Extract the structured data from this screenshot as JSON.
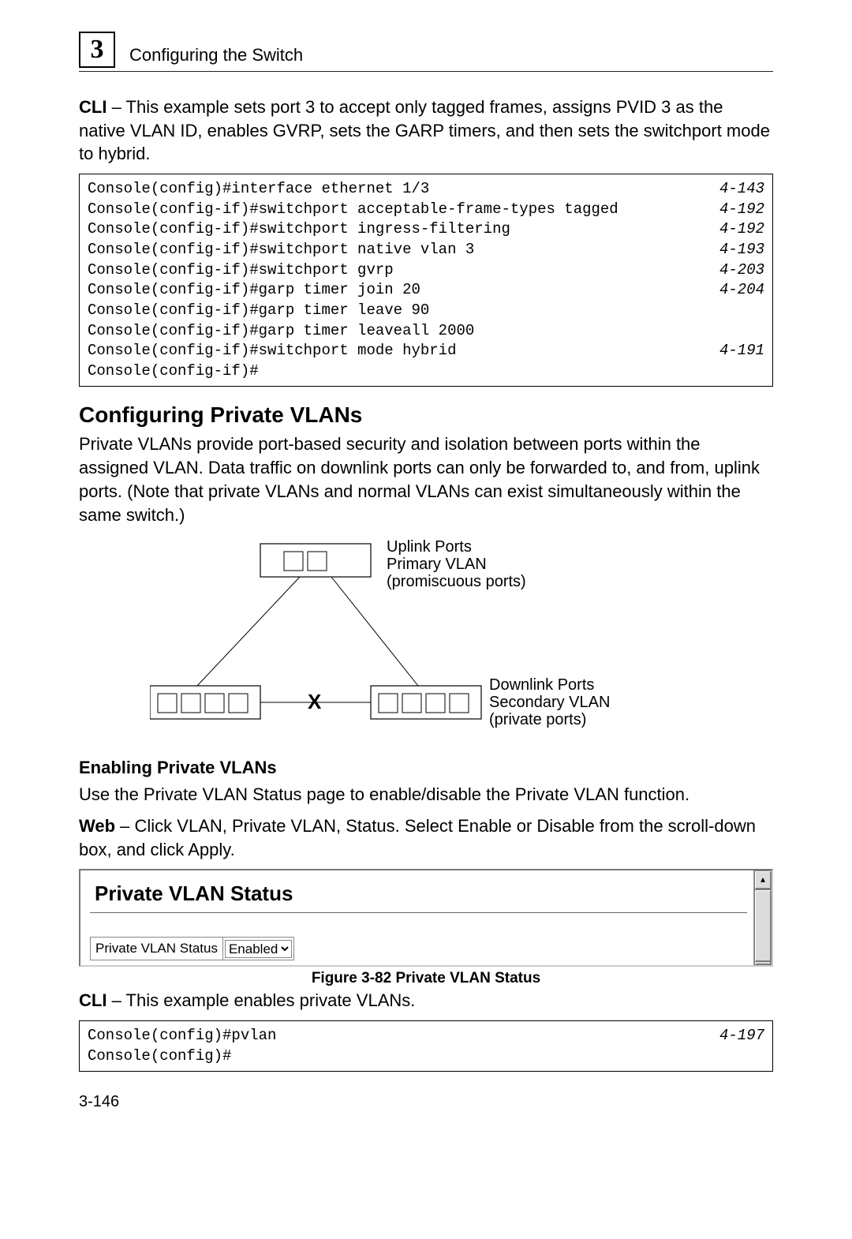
{
  "header": {
    "chapter_number": "3",
    "chapter_title": "Configuring the Switch"
  },
  "intro": {
    "bold": "CLI",
    "text": " – This example sets port 3 to accept only tagged frames, assigns PVID 3 as the native VLAN ID, enables GVRP, sets the GARP timers, and then sets the switchport mode to hybrid."
  },
  "cli1": {
    "lines": [
      {
        "cmd": "Console(config)#interface ethernet 1/3",
        "ref": "4-143"
      },
      {
        "cmd": "Console(config-if)#switchport acceptable-frame-types tagged",
        "ref": "4-192"
      },
      {
        "cmd": "Console(config-if)#switchport ingress-filtering",
        "ref": "4-192"
      },
      {
        "cmd": "Console(config-if)#switchport native vlan 3",
        "ref": "4-193"
      },
      {
        "cmd": "Console(config-if)#switchport gvrp",
        "ref": "4-203"
      },
      {
        "cmd": "Console(config-if)#garp timer join 20",
        "ref": "4-204"
      },
      {
        "cmd": "Console(config-if)#garp timer leave 90",
        "ref": ""
      },
      {
        "cmd": "Console(config-if)#garp timer leaveall 2000",
        "ref": ""
      },
      {
        "cmd": "Console(config-if)#switchport mode hybrid",
        "ref": "4-191"
      },
      {
        "cmd": "Console(config-if)#",
        "ref": ""
      }
    ]
  },
  "section": {
    "heading": "Configuring Private VLANs",
    "paragraph": "Private VLANs provide port-based security and isolation between ports within the assigned VLAN. Data traffic on downlink ports can only be forwarded to, and from, uplink ports. (Note that private VLANs and normal VLANs can exist simultaneously within the same switch.)"
  },
  "diagram": {
    "uplink_label_1": "Uplink Ports",
    "uplink_label_2": "Primary VLAN",
    "uplink_label_3": "(promiscuous ports)",
    "downlink_label_1": "Downlink Ports",
    "downlink_label_2": "Secondary VLAN",
    "downlink_label_3": "(private ports)",
    "x_mark": "X"
  },
  "subsection": {
    "heading": "Enabling Private VLANs",
    "p1": "Use the Private VLAN Status page to enable/disable the Private VLAN function.",
    "p2_bold": "Web",
    "p2": " – Click VLAN, Private VLAN, Status. Select Enable or Disable from the scroll-down box, and click Apply."
  },
  "ui": {
    "title": "Private VLAN Status",
    "row_label": "Private VLAN Status",
    "select_value": "Enabled"
  },
  "figure_caption": "Figure 3-82   Private VLAN Status",
  "cli2_intro_bold": "CLI",
  "cli2_intro": " – This example enables private VLANs.",
  "cli2": {
    "lines": [
      {
        "cmd": "Console(config)#pvlan",
        "ref": "4-197"
      },
      {
        "cmd": "Console(config)#",
        "ref": ""
      }
    ]
  },
  "page_number": "3-146"
}
